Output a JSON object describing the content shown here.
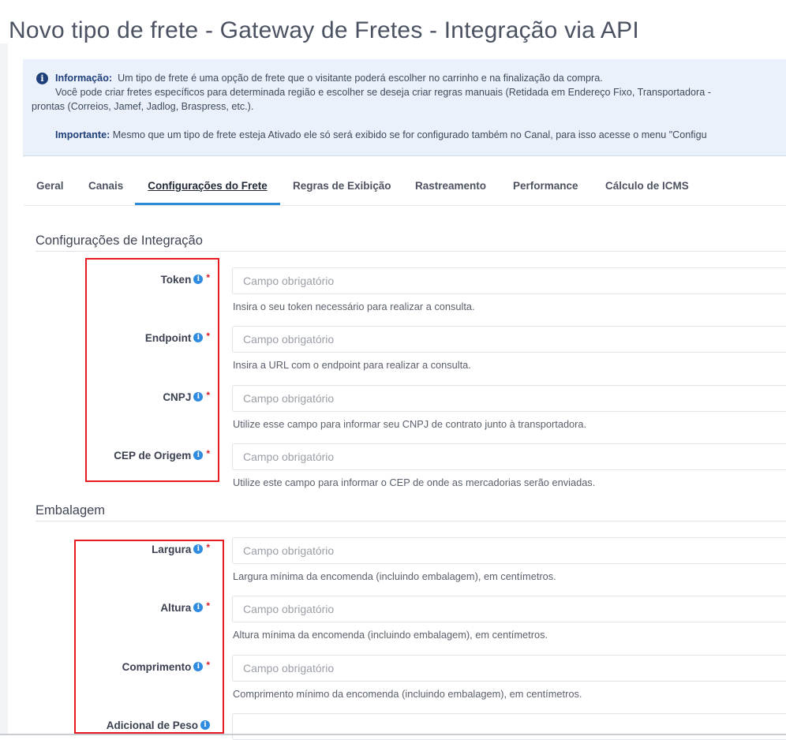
{
  "page": {
    "title": "Novo tipo de frete - Gateway de Fretes - Integração via API"
  },
  "alert": {
    "icon": "info-icon",
    "info_label": "Informação:",
    "info_text": "Um tipo de frete é uma opção de frete que o visitante poderá escolher no carrinho e na finalização da compra.",
    "info_line2": "Você pode criar fretes específicos para determinada região e escolher se deseja criar regras manuais (Retidada em Endereço Fixo, Transportadora -",
    "info_line3": "prontas (Correios, Jamef, Jadlog, Braspress, etc.).",
    "important_label": "Importante:",
    "important_text": "Mesmo que um tipo de frete esteja Ativado ele só será exibido se for configurado também no Canal, para isso acesse o menu \"Configu"
  },
  "tabs": [
    {
      "label": "Geral"
    },
    {
      "label": "Canais"
    },
    {
      "label": "Configurações do Frete",
      "active": true
    },
    {
      "label": "Regras de Exibição"
    },
    {
      "label": "Rastreamento"
    },
    {
      "label": "Performance"
    },
    {
      "label": "Cálculo de ICMS"
    }
  ],
  "sections": {
    "integration": {
      "title": "Configurações de Integração",
      "fields": [
        {
          "label": "Token",
          "required": "*",
          "placeholder": "Campo obrigatório",
          "hint": "Insira o seu token necessário para realizar a consulta."
        },
        {
          "label": "Endpoint",
          "required": "*",
          "placeholder": "Campo obrigatório",
          "hint": "Insira a URL com o endpoint para realizar a consulta."
        },
        {
          "label": "CNPJ",
          "required": "*",
          "placeholder": "Campo obrigatório",
          "hint": "Utilize esse campo para informar seu CNPJ de contrato junto à transportadora."
        },
        {
          "label": "CEP de Origem",
          "required": "*",
          "placeholder": "Campo obrigatório",
          "hint": "Utilize este campo para informar o CEP de onde as mercadorias serão enviadas."
        }
      ]
    },
    "packaging": {
      "title": "Embalagem",
      "fields": [
        {
          "label": "Largura",
          "required": "*",
          "placeholder": "Campo obrigatório",
          "hint": "Largura mínima da encomenda (incluindo embalagem), em centímetros."
        },
        {
          "label": "Altura",
          "required": "*",
          "placeholder": "Campo obrigatório",
          "hint": "Altura mínima da encomenda (incluindo embalagem), em centímetros."
        },
        {
          "label": "Comprimento",
          "required": "*",
          "placeholder": "Campo obrigatório",
          "hint": "Comprimento mínimo da encomenda (incluindo embalagem), em centímetros."
        },
        {
          "label": "Adicional de Peso",
          "required": "",
          "placeholder": "",
          "hint": ""
        }
      ]
    }
  },
  "colors": {
    "accent": "#2a8cd8",
    "required": "#d8212a",
    "highlight": "#e81b22",
    "alert_bg": "#eaf1fb"
  }
}
